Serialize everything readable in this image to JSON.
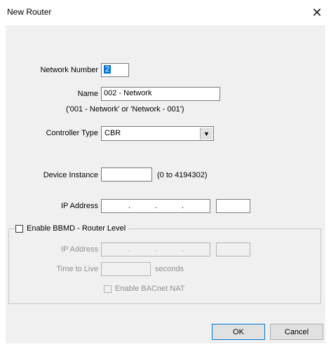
{
  "window": {
    "title": "New Router"
  },
  "network_number": {
    "label": "Network Number",
    "value": "2"
  },
  "name": {
    "label": "Name",
    "value": "002 - Network",
    "hint": "('001 - Network' or 'Network - 001')"
  },
  "controller_type": {
    "label": "Controller Type",
    "value": "CBR"
  },
  "device_instance": {
    "label": "Device Instance",
    "value": "",
    "range": "(0 to 4194302)"
  },
  "ip_address": {
    "label": "IP Address",
    "separator": "."
  },
  "bbmd": {
    "checkbox_label": "Enable BBMD - Router Level",
    "checked": false,
    "ip_label": "IP Address",
    "ttl_label": "Time to Live",
    "ttl_unit": "seconds",
    "nat_label": "Enable BACnet NAT",
    "nat_checked": false
  },
  "buttons": {
    "ok": "OK",
    "cancel": "Cancel"
  }
}
